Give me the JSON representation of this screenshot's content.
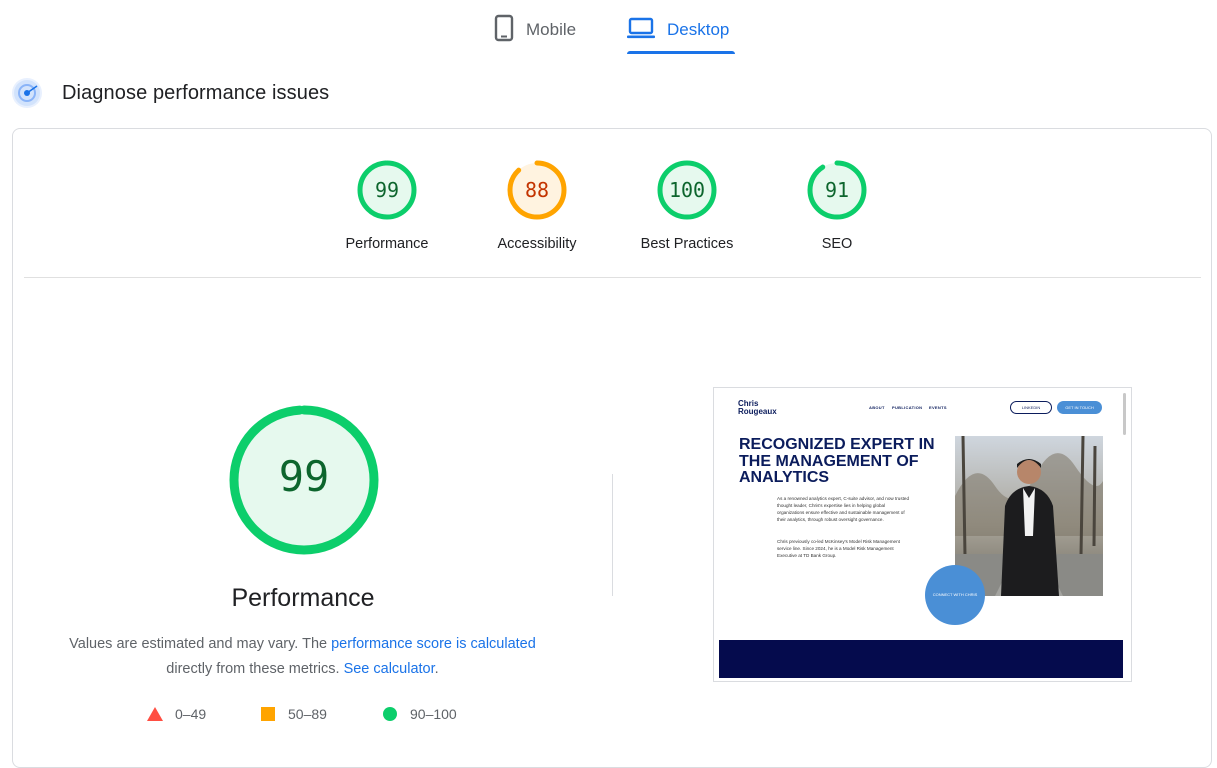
{
  "tabs": [
    {
      "label": "Mobile",
      "icon": "mobile-phone-icon",
      "selected": false
    },
    {
      "label": "Desktop",
      "icon": "desktop-laptop-icon",
      "selected": true
    }
  ],
  "diagnose": {
    "title": "Diagnose performance issues",
    "icon": "lighthouse-icon"
  },
  "categories": [
    {
      "label": "Performance",
      "score": "99",
      "fraction": 0.99,
      "color": "#0cce6b",
      "text_color": "#0d652d",
      "fill": "#e6f9ee"
    },
    {
      "label": "Accessibility",
      "score": "88",
      "fraction": 0.88,
      "color": "#ffa400",
      "text_color": "#c33300",
      "fill": "#fff3e0"
    },
    {
      "label": "Best Practices",
      "score": "100",
      "fraction": 1.0,
      "color": "#0cce6b",
      "text_color": "#0d652d",
      "fill": "#e6f9ee"
    },
    {
      "label": "SEO",
      "score": "91",
      "fraction": 0.91,
      "color": "#0cce6b",
      "text_color": "#0d652d",
      "fill": "#e6f9ee"
    }
  ],
  "performance": {
    "score": "99",
    "fraction": 0.99,
    "title": "Performance",
    "desc_prefix": "Values are estimated and may vary. The ",
    "desc_link1": "performance score is calculated",
    "desc_middle": " directly from these metrics. ",
    "desc_link2": "See calculator",
    "desc_suffix": "."
  },
  "legend": [
    {
      "range": "0–49",
      "shape": "triangle",
      "color": "#ff4e42"
    },
    {
      "range": "50–89",
      "shape": "square",
      "color": "#ffa400"
    },
    {
      "range": "90–100",
      "shape": "circle",
      "color": "#0cce6b"
    }
  ],
  "screenshot": {
    "logo_line1": "Chris",
    "logo_line2": "Rougeaux",
    "nav": [
      "ABOUT",
      "PUBLICATION",
      "EVENTS"
    ],
    "linkedin_btn": "LINKEDIN",
    "contact_btn": "GET IN TOUCH",
    "headline": "RECOGNIZED EXPERT IN THE MANAGEMENT OF ANALYTICS",
    "para1": "As a renowned analytics expert, C-suite advisor, and now trusted thought leader, Chris's expertise lies in helping global organizations ensure effective and sustainable management of their analytics, through robust oversight governance.",
    "para2": "Chris previously co-led McKinsey's Model Risk Management service line. Since 2024, he is a Model Risk Management Executive at TD Bank Group.",
    "cta": "CONNECT WITH CHRIS"
  }
}
